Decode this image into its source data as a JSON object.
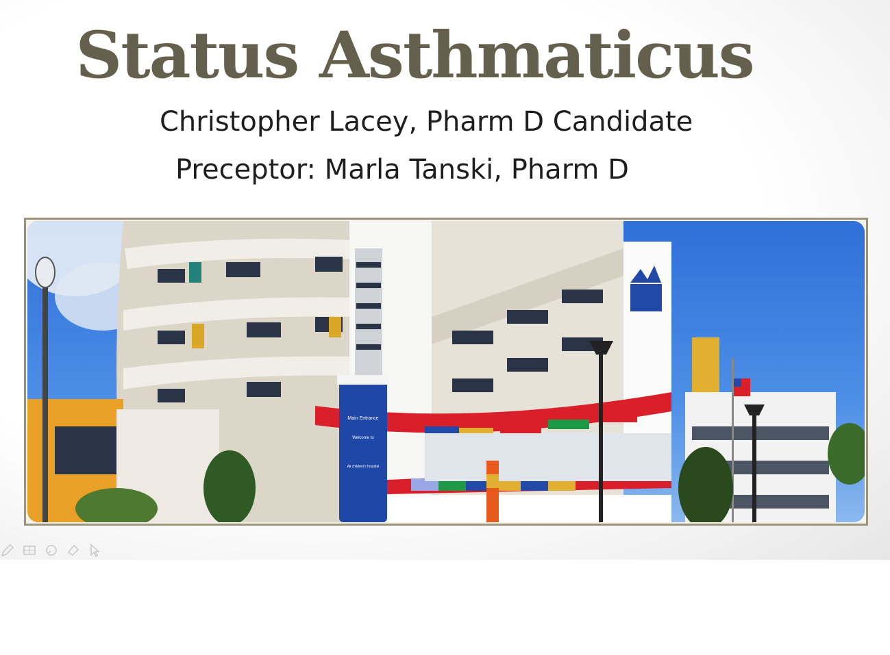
{
  "slide": {
    "title": "Status Asthmaticus",
    "author_line": "Christopher Lacey, Pharm D Candidate",
    "preceptor_line": "Preceptor: Marla Tanski, Pharm D"
  },
  "photo": {
    "sign_top": "Main Entrance",
    "sign_welcome": "Welcome to",
    "sign_hospital": "All children's hospital"
  },
  "toolbar": {
    "tools": [
      "pen-icon",
      "slides-grid-icon",
      "zoom-icon",
      "eraser-icon",
      "pointer-icon"
    ]
  },
  "colors": {
    "title": "#655f4d",
    "frame": "#9a957a"
  }
}
